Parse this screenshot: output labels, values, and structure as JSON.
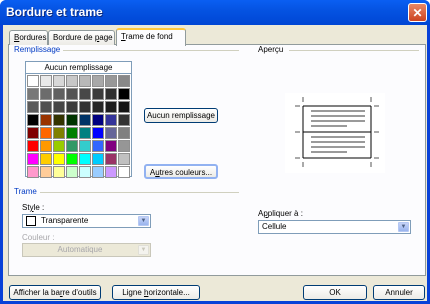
{
  "window": {
    "title": "Bordure et trame",
    "close_glyph": "✕"
  },
  "tabs": [
    {
      "prefix": "",
      "accel": "B",
      "suffix": "ordures"
    },
    {
      "prefix": "Bordure de ",
      "accel": "p",
      "suffix": "age"
    },
    {
      "prefix": "",
      "accel": "T",
      "suffix": "rame de fond"
    }
  ],
  "fill": {
    "group_label": "Remplissage",
    "no_fill_header": "Aucun remplissage",
    "no_fill_button": "Aucun remplissage",
    "more_colors": {
      "prefix": "A",
      "accel": "u",
      "suffix": "tres couleurs..."
    },
    "palette": [
      [
        "#ffffff",
        "#e9e9e9",
        "#d8d8d8",
        "#c8c8c8",
        "#b8b8b8",
        "#a8a8a8",
        "#989898",
        "#888888"
      ],
      [
        "#787878",
        "#6c6c6c",
        "#606060",
        "#545454",
        "#484848",
        "#3c3c3c",
        "#303030",
        "#000000"
      ],
      [
        "#5a5a5a",
        "#505050",
        "#464646",
        "#3c3c3c",
        "#323232",
        "#282828",
        "#1e1e1e",
        "#141414"
      ],
      [
        "#000000",
        "#993300",
        "#333300",
        "#003300",
        "#003366",
        "#000080",
        "#333399",
        "#333333"
      ],
      [
        "#800000",
        "#ff6600",
        "#808000",
        "#008000",
        "#008080",
        "#0000ff",
        "#666699",
        "#808080"
      ],
      [
        "#ff0000",
        "#ff9900",
        "#99cc00",
        "#339966",
        "#33cccc",
        "#3366ff",
        "#800080",
        "#969696"
      ],
      [
        "#ff00ff",
        "#ffcc00",
        "#ffff00",
        "#00ff00",
        "#00ffff",
        "#00ccff",
        "#993366",
        "#c0c0c0"
      ],
      [
        "#ff99cc",
        "#ffcc99",
        "#ffff99",
        "#ccffcc",
        "#ccffff",
        "#99ccff",
        "#cc99ff",
        "#ffffff"
      ]
    ]
  },
  "pattern": {
    "group_label": "Trame",
    "style_label": {
      "prefix": "St",
      "accel": "y",
      "suffix": "le :"
    },
    "style_value": "Transparente",
    "color_label": "Couleur :",
    "color_value": "Automatique"
  },
  "preview": {
    "label": "Aperçu",
    "apply_label": {
      "prefix": "A",
      "accel": "p",
      "suffix": "pliquer à :"
    },
    "apply_value": "Cellule"
  },
  "footer": {
    "toolbar_button": {
      "prefix": "Afficher la ba",
      "accel": "r",
      "suffix": "re d'outils"
    },
    "hline_button": {
      "prefix": "Ligne ",
      "accel": "h",
      "suffix": "orizontale..."
    },
    "ok": "OK",
    "cancel": "Annuler"
  }
}
